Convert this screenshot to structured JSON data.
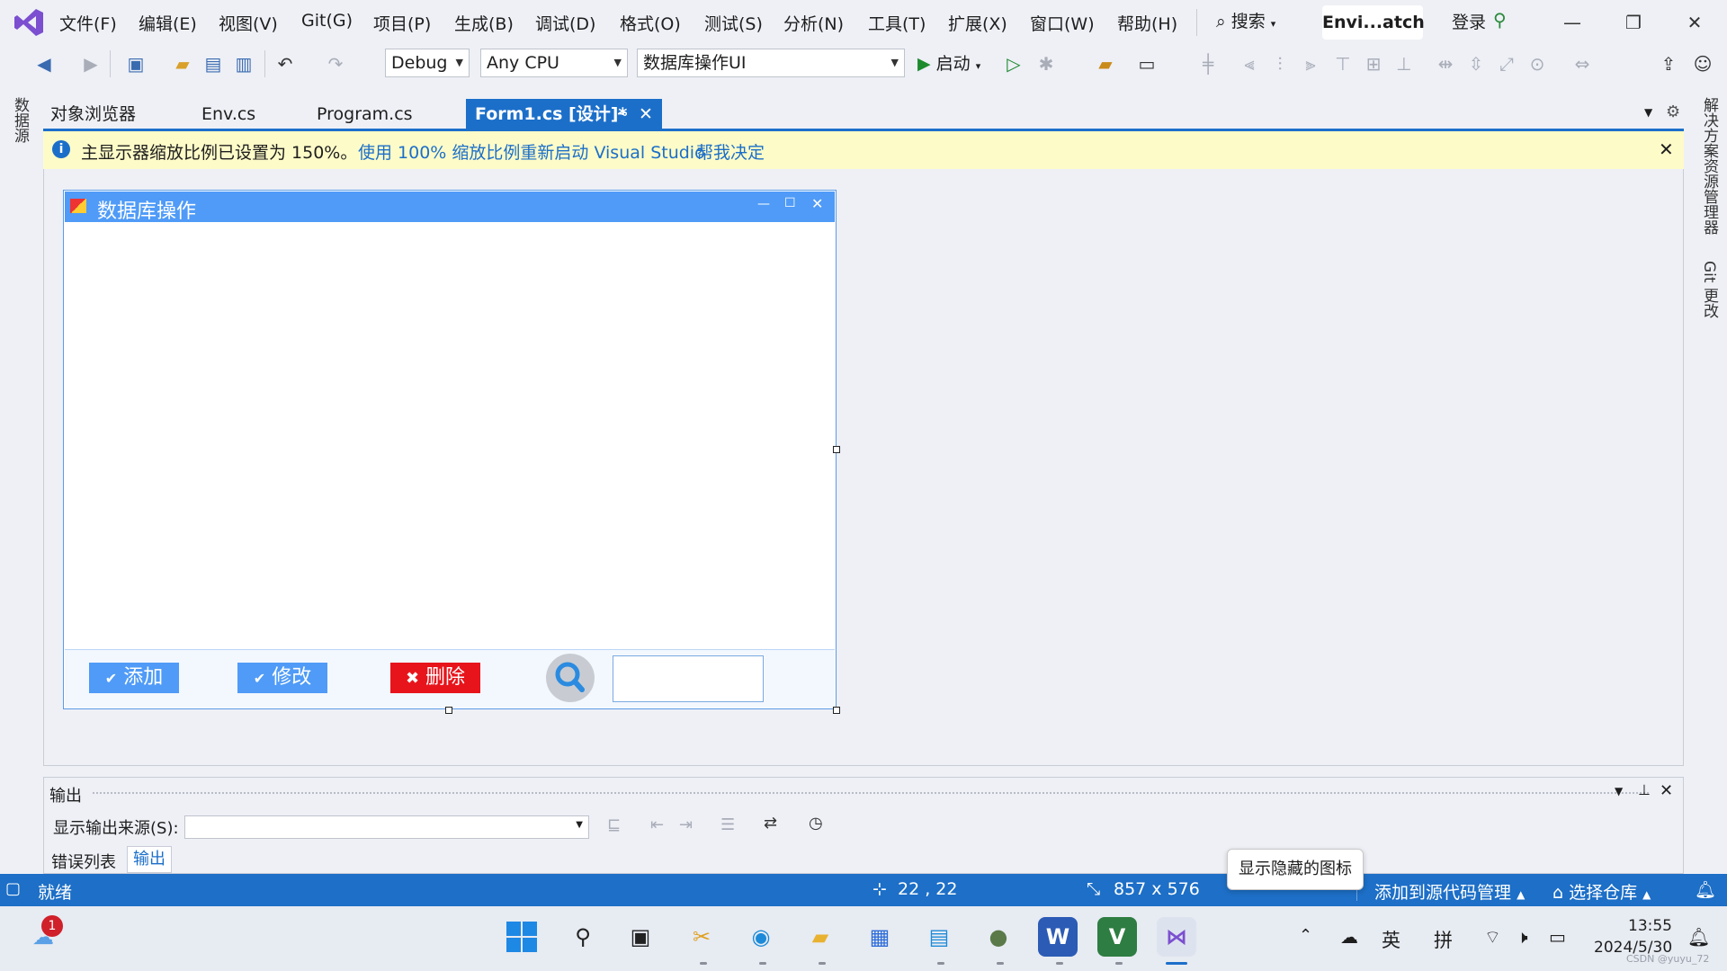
{
  "colors": {
    "accent": "#1c6fc9",
    "form_title_bar": "#4f9bf7",
    "infobar_bg": "#fdfbc8",
    "delete_red": "#e8141c",
    "button_blue": "#4f9bf7"
  },
  "menu": [
    "文件(F)",
    "编辑(E)",
    "视图(V)",
    "Git(G)",
    "项目(P)",
    "生成(B)",
    "调试(D)",
    "格式(O)",
    "测试(S)",
    "分析(N)",
    "工具(T)",
    "扩展(X)",
    "窗口(W)",
    "帮助(H)"
  ],
  "search_label": "搜索",
  "solution_name": "Envi...atch",
  "login_label": "登录",
  "toolbar": {
    "config": "Debug",
    "platform": "Any CPU",
    "project": "数据库操作UI",
    "start_label": "启动"
  },
  "left_rail_label": "数据源",
  "right_rail": [
    "解决方案资源管理器",
    "Git 更改"
  ],
  "tabs": [
    "对象浏览器",
    "Env.cs",
    "Program.cs"
  ],
  "active_tab": "Form1.cs [设计]*",
  "infobar": {
    "message": "主显示器缩放比例已设置为 150%。",
    "link1": "使用 100% 缩放比例重新启动 Visual Studio",
    "link2": "帮我决定"
  },
  "form": {
    "title": "数据库操作",
    "add_label": "添加",
    "edit_label": "修改",
    "delete_label": "删除"
  },
  "output": {
    "title": "输出",
    "source_label": "显示输出来源(S):",
    "tabs": [
      "错误列表",
      "输出"
    ]
  },
  "status": {
    "ready": "就绪",
    "position": "22 , 22",
    "size": "857 x 576",
    "tooltip": "显示隐藏的图标",
    "source_control": "添加到源代码管理",
    "repo": "选择仓库"
  },
  "taskbar": {
    "weather_badge": "1",
    "ime_lang": "英",
    "ime_mode": "拼",
    "time": "13:55",
    "date": "2024/5/30",
    "watermark": "CSDN @yuyu_72"
  }
}
